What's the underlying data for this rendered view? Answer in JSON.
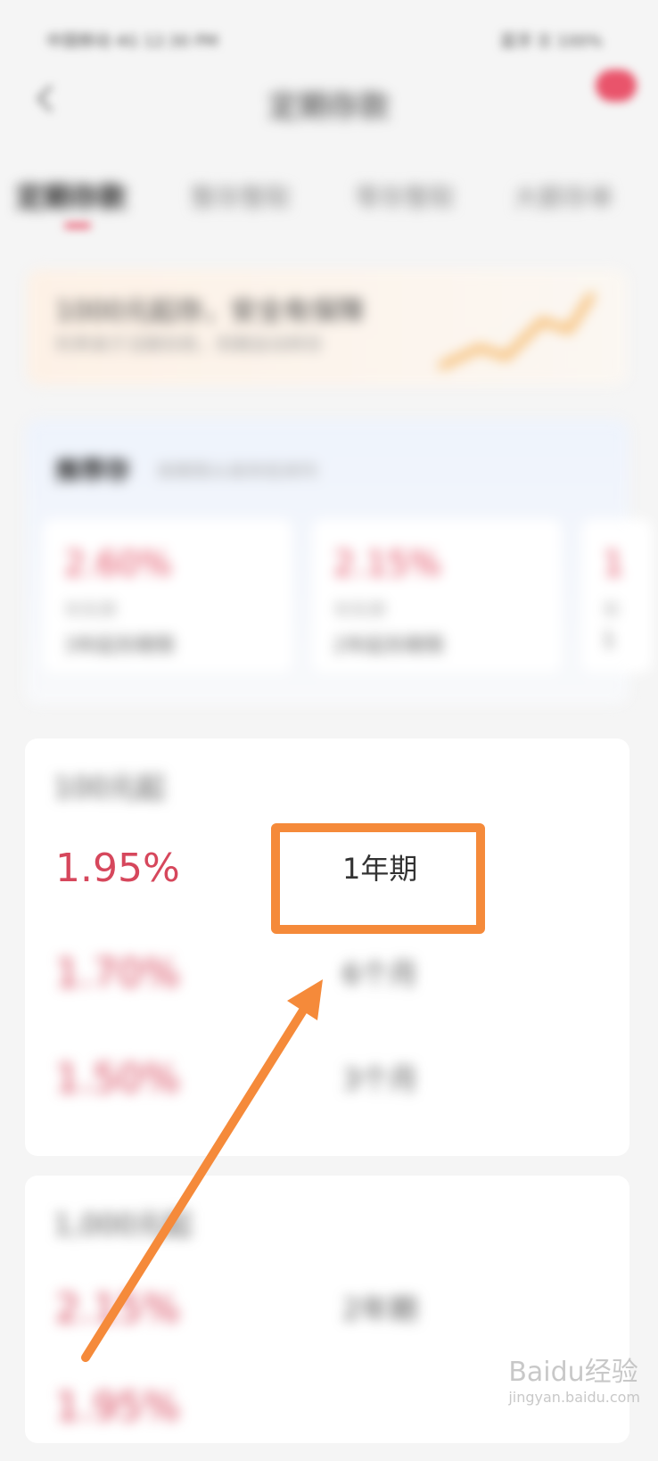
{
  "status_bar": {
    "left": "中国移动 4G 12:30 PM",
    "right": "蓝牙 ☰ 100%"
  },
  "header": {
    "title": "定期存款"
  },
  "tabs": [
    "定期存款",
    "整存整取",
    "零存整取",
    "大额存单"
  ],
  "banner": {
    "title": "1000元起存，安全有保障",
    "subtitle": "利率高于活期存款，到期自动转存"
  },
  "recommend": {
    "title": "推荐存",
    "subtitle": "按期限从高到低排列",
    "items": [
      {
        "rate": "2.60%",
        "label": "年利率",
        "term": "3年起存期限"
      },
      {
        "rate": "2.15%",
        "label": "年利率",
        "term": "2年起存期限"
      },
      {
        "rate": "1",
        "label": "年",
        "term": "1"
      }
    ]
  },
  "list1": {
    "title": "100元起",
    "rows": [
      {
        "rate": "1.95%",
        "term": "1年期"
      },
      {
        "rate": "1.70%",
        "term": "6个月"
      },
      {
        "rate": "1.50%",
        "term": "3个月"
      }
    ]
  },
  "list2": {
    "title": "1,000元起",
    "rows": [
      {
        "rate": "2.15%",
        "term": "2年期"
      },
      {
        "rate": "1.95%",
        "term": ""
      }
    ]
  },
  "watermark": {
    "brand": "Baidu经验",
    "url": "jingyan.baidu.com"
  },
  "colors": {
    "accent": "#f58a3a",
    "rate_red": "#d6475c"
  }
}
